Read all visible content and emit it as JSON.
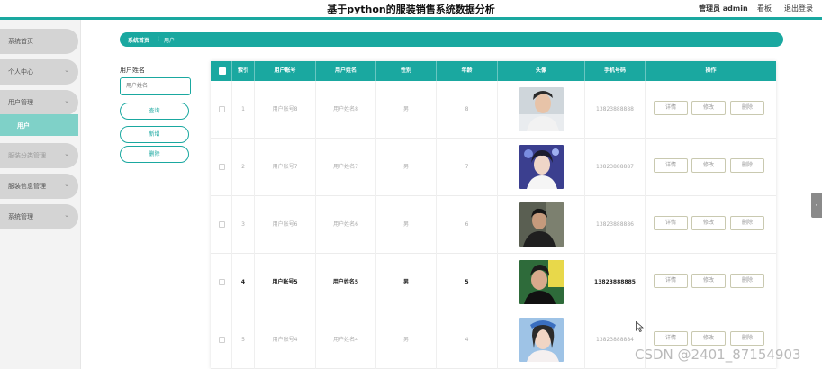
{
  "header": {
    "title": "基于python的服装销售系统数据分析",
    "admin": "管理员 admin",
    "board": "看板",
    "logout": "退出登录"
  },
  "sidebar": {
    "items": [
      {
        "label": "系统首页",
        "chevron": ""
      },
      {
        "label": "个人中心",
        "chevron": "⌄"
      },
      {
        "label": "用户管理",
        "chevron": "⌄"
      },
      {
        "label": "服装分类管理",
        "chevron": "⌄"
      },
      {
        "label": "服装信息管理",
        "chevron": "⌄"
      },
      {
        "label": "系统管理",
        "chevron": "⌄"
      }
    ],
    "sub_item": "用户"
  },
  "breadcrumb": {
    "home": "系统首页",
    "sep": "⋮",
    "current": "用户"
  },
  "search": {
    "label": "用户姓名",
    "placeholder": "用户姓名",
    "query_button": "查询",
    "add_button": "新增",
    "delete_button": "删除"
  },
  "table": {
    "columns": [
      "索引",
      "用户账号",
      "用户姓名",
      "性别",
      "年龄",
      "头像",
      "手机号码",
      "操作"
    ],
    "rows": [
      {
        "index": "1",
        "account": "用户账号8",
        "name": "用户姓名8",
        "gender": "男",
        "age": "8",
        "phone": "13823888888",
        "avatar": "person-photo-1"
      },
      {
        "index": "2",
        "account": "用户账号7",
        "name": "用户姓名7",
        "gender": "男",
        "age": "7",
        "phone": "13823888887",
        "avatar": "person-photo-2"
      },
      {
        "index": "3",
        "account": "用户账号6",
        "name": "用户姓名6",
        "gender": "男",
        "age": "6",
        "phone": "13823888886",
        "avatar": "person-photo-3"
      },
      {
        "index": "4",
        "account": "用户账号5",
        "name": "用户姓名5",
        "gender": "男",
        "age": "5",
        "phone": "13823888885",
        "avatar": "person-photo-4"
      },
      {
        "index": "5",
        "account": "用户账号4",
        "name": "用户姓名4",
        "gender": "男",
        "age": "4",
        "phone": "13823888884",
        "avatar": "person-photo-5"
      }
    ],
    "actions": {
      "detail": "详情",
      "edit": "修改",
      "delete": "删除"
    }
  },
  "watermark": "CSDN @2401_87154903",
  "colors": {
    "accent": "#1aa8a0",
    "sidebar_active": "#7fd1c8",
    "sidebar_item": "#d4d4d4"
  }
}
